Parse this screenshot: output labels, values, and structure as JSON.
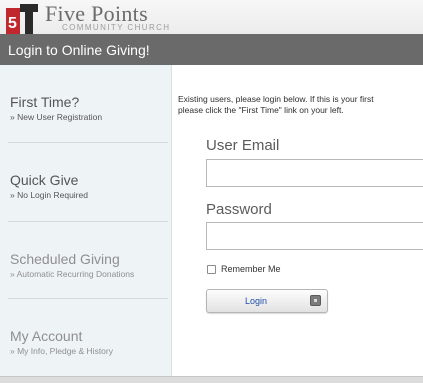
{
  "header": {
    "logo_title": "Five Points",
    "logo_subtitle": "COMMUNITY CHURCH",
    "logo_colors": {
      "red": "#c0282d",
      "dark": "#2a2a2a"
    }
  },
  "title_bar": {
    "text": "Login to Online Giving!"
  },
  "sidebar": {
    "items": [
      {
        "title": "First Time?",
        "subtitle": "» New User Registration"
      },
      {
        "title": "Quick Give",
        "subtitle": "» No Login Required"
      },
      {
        "title": "Scheduled Giving",
        "subtitle": "» Automatic Recurring Donations"
      },
      {
        "title": "My Account",
        "subtitle": "» My Info, Pledge & History"
      }
    ]
  },
  "main": {
    "intro_line1": "Existing users, please login below. If this is your first",
    "intro_line2": "please click the \"First Time\" link on your left.",
    "email_label": "User Email",
    "email_value": "",
    "password_label": "Password",
    "password_value": "",
    "remember_label": "Remember Me",
    "login_label": "Login"
  },
  "colors": {
    "title_bar_bg": "#6a6a6a",
    "sidebar_bg": "#eef3f6",
    "login_text": "#1f4fa8"
  }
}
